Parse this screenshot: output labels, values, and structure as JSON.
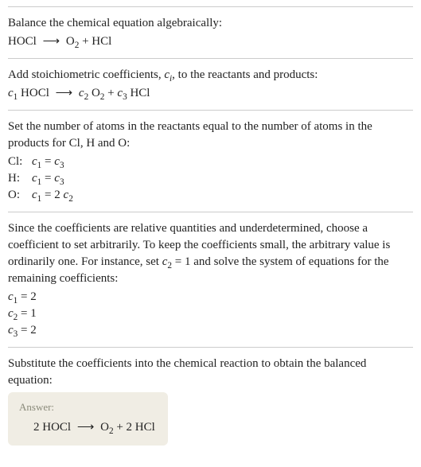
{
  "section1": {
    "intro": "Balance the chemical equation algebraically:",
    "eq_prefix": "HOCl ",
    "eq_arrow": "⟶",
    "eq_suffix_a": " O",
    "eq_suffix_sub": "2",
    "eq_suffix_b": " + HCl"
  },
  "section2": {
    "intro_a": "Add stoichiometric coefficients, ",
    "intro_ci": "c",
    "intro_ci_sub": "i",
    "intro_b": ", to the reactants and products:",
    "eq_c1": "c",
    "eq_c1_sub": "1",
    "eq_hocl": " HOCl ",
    "eq_arrow": "⟶",
    "eq_c2": " c",
    "eq_c2_sub": "2",
    "eq_o": " O",
    "eq_o_sub": "2",
    "eq_plus": " + ",
    "eq_c3": "c",
    "eq_c3_sub": "3",
    "eq_hcl": " HCl"
  },
  "section3": {
    "intro": "Set the number of atoms in the reactants equal to the number of atoms in the products for Cl, H and O:",
    "rows": [
      {
        "label": "Cl:",
        "lhs_c": "c",
        "lhs_sub": "1",
        "eq": " = ",
        "rhs_c": "c",
        "rhs_sub": "3",
        "coef": ""
      },
      {
        "label": "H:",
        "lhs_c": "c",
        "lhs_sub": "1",
        "eq": " = ",
        "rhs_c": "c",
        "rhs_sub": "3",
        "coef": ""
      },
      {
        "label": "O:",
        "lhs_c": "c",
        "lhs_sub": "1",
        "eq": " = ",
        "rhs_c": "c",
        "rhs_sub": "2",
        "coef": "2 "
      }
    ]
  },
  "section4": {
    "intro_a": "Since the coefficients are relative quantities and underdetermined, choose a coefficient to set arbitrarily. To keep the coefficients small, the arbitrary value is ordinarily one. For instance, set ",
    "intro_c2": "c",
    "intro_c2_sub": "2",
    "intro_b": " = 1 and solve the system of equations for the remaining coefficients:",
    "sol": [
      {
        "c": "c",
        "sub": "1",
        "val": " = 2"
      },
      {
        "c": "c",
        "sub": "2",
        "val": " = 1"
      },
      {
        "c": "c",
        "sub": "3",
        "val": " = 2"
      }
    ]
  },
  "section5": {
    "intro": "Substitute the coefficients into the chemical reaction to obtain the balanced equation:",
    "answer_label": "Answer:",
    "eq_a": "2 HOCl ",
    "eq_arrow": "⟶",
    "eq_b": " O",
    "eq_sub": "2",
    "eq_c": " + 2 HCl"
  }
}
